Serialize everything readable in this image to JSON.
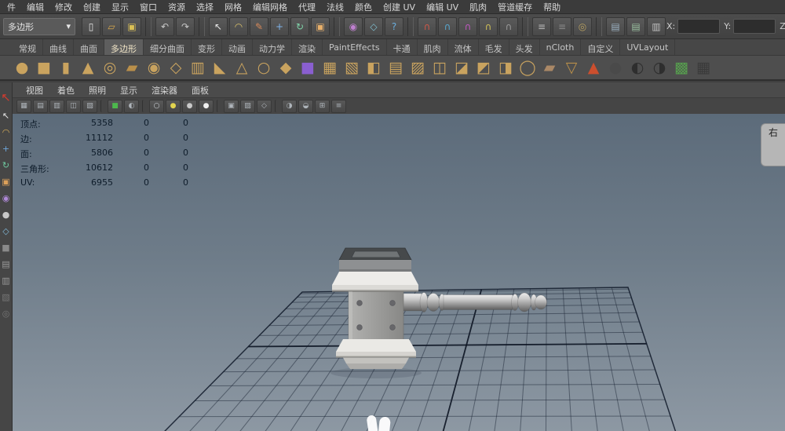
{
  "colors": {
    "viewport_top": "#5c6b7a",
    "viewport_bottom": "#8d98a3",
    "shelf_icon_tan": "#c9a35f",
    "active_tab_text": "#f2e6c8"
  },
  "menubar": {
    "items": [
      "件",
      "编辑",
      "修改",
      "创建",
      "显示",
      "窗口",
      "资源",
      "选择",
      "网格",
      "编辑网格",
      "代理",
      "法线",
      "颜色",
      "创建 UV",
      "编辑 UV",
      "肌肉",
      "管道缓存",
      "帮助"
    ]
  },
  "toolbar": {
    "menuset": "多边形",
    "menuset_caret": "▾",
    "trailing_glyph": "▾",
    "icons": [
      {
        "name": "new-scene",
        "glyph": "▯",
        "color": "#e5e5e5"
      },
      {
        "name": "open-scene",
        "glyph": "▱",
        "color": "#d9a94d"
      },
      {
        "name": "save-scene",
        "glyph": "▣",
        "color": "#d9bf55"
      },
      {
        "sep": true,
        "glyph": ""
      },
      {
        "name": "undo",
        "glyph": "↶",
        "color": "#c9c9c9"
      },
      {
        "name": "redo",
        "glyph": "↷",
        "color": "#c9c9c9"
      },
      {
        "sep": true,
        "glyph": ""
      },
      {
        "name": "select-tool",
        "glyph": "↖",
        "color": "#e8e8e8"
      },
      {
        "name": "lasso-tool",
        "glyph": "◠",
        "color": "#d9c06a"
      },
      {
        "name": "paint-select-tool",
        "glyph": "✎",
        "color": "#d98a5a"
      },
      {
        "name": "move-tool",
        "glyph": "+",
        "color": "#7fb2e8"
      },
      {
        "name": "rotate-tool",
        "glyph": "↻",
        "color": "#7fd2a8"
      },
      {
        "name": "scale-tool",
        "glyph": "▣",
        "color": "#e8b06a"
      },
      {
        "sep": true,
        "glyph": ""
      },
      {
        "name": "soft-mod",
        "glyph": "◉",
        "color": "#c080d0"
      },
      {
        "name": "show-manipulator",
        "glyph": "◇",
        "color": "#80c0d0"
      },
      {
        "name": "help",
        "glyph": "?",
        "color": "#6aaede"
      },
      {
        "sep": true,
        "glyph": ""
      },
      {
        "name": "snap-grid",
        "glyph": "∩",
        "color": "#d05848"
      },
      {
        "name": "snap-curve",
        "glyph": "∩",
        "color": "#58a8d0"
      },
      {
        "name": "snap-point",
        "glyph": "∩",
        "color": "#c058c0"
      },
      {
        "name": "snap-projected",
        "glyph": "∩",
        "color": "#d0c058"
      },
      {
        "name": "snap-view",
        "glyph": "∩",
        "color": "#9a9a9a"
      },
      {
        "sep": true,
        "glyph": ""
      },
      {
        "name": "input-connections",
        "glyph": "≡",
        "color": "#b8b8b8"
      },
      {
        "name": "output-connections",
        "glyph": "≡",
        "color": "#8a8a8a"
      },
      {
        "name": "construction-history",
        "glyph": "◎",
        "color": "#b8a060"
      },
      {
        "sep": true,
        "glyph": ""
      },
      {
        "name": "render-current-frame",
        "glyph": "▤",
        "color": "#9ab0c0"
      },
      {
        "name": "ipr-render",
        "glyph": "▤",
        "color": "#9ac0a0"
      },
      {
        "name": "render-settings",
        "glyph": "▥",
        "color": "#c0c0c0"
      }
    ],
    "axis_fields": [
      {
        "label": "X:",
        "value": ""
      },
      {
        "label": "Y:",
        "value": ""
      },
      {
        "label": "Z:",
        "value": ""
      }
    ]
  },
  "shelf": {
    "tabs": [
      {
        "label": "常规"
      },
      {
        "label": "曲线"
      },
      {
        "label": "曲面"
      },
      {
        "label": "多边形",
        "active": true
      },
      {
        "label": "细分曲面"
      },
      {
        "label": "变形"
      },
      {
        "label": "动画"
      },
      {
        "label": "动力学"
      },
      {
        "label": "渲染"
      },
      {
        "label": "PaintEffects"
      },
      {
        "label": "卡通"
      },
      {
        "label": "肌肉"
      },
      {
        "label": "流体"
      },
      {
        "label": "毛发"
      },
      {
        "label": "头发"
      },
      {
        "label": "nCloth"
      },
      {
        "label": "自定义"
      },
      {
        "label": "UVLayout"
      }
    ],
    "icons": [
      {
        "name": "poly-sphere",
        "glyph": "●",
        "color": "#c9a35f"
      },
      {
        "name": "poly-cube",
        "glyph": "■",
        "color": "#c9a35f"
      },
      {
        "name": "poly-cylinder",
        "glyph": "▮",
        "color": "#c9a35f"
      },
      {
        "name": "poly-cone",
        "glyph": "▲",
        "color": "#c9a35f"
      },
      {
        "name": "poly-torus",
        "glyph": "◎",
        "color": "#c9a35f"
      },
      {
        "name": "poly-plane",
        "glyph": "▰",
        "color": "#b98f4a"
      },
      {
        "name": "poly-disc",
        "glyph": "◉",
        "color": "#c9a35f"
      },
      {
        "name": "poly-helix",
        "glyph": "◇",
        "color": "#c9a35f"
      },
      {
        "name": "poly-pipe",
        "glyph": "▥",
        "color": "#c9a35f"
      },
      {
        "name": "poly-prism",
        "glyph": "◣",
        "color": "#c9a35f"
      },
      {
        "name": "poly-pyramid",
        "glyph": "△",
        "color": "#c9a35f"
      },
      {
        "name": "poly-soccer",
        "glyph": "○",
        "color": "#c9a35f"
      },
      {
        "name": "poly-platonic",
        "glyph": "◆",
        "color": "#c9a35f"
      },
      {
        "name": "smooth-cube",
        "glyph": "■",
        "color": "#8a5fd0"
      },
      {
        "name": "combine",
        "glyph": "▦",
        "color": "#c9a35f"
      },
      {
        "name": "extract",
        "glyph": "▧",
        "color": "#c9a35f"
      },
      {
        "name": "boolean",
        "glyph": "◧",
        "color": "#c9a35f"
      },
      {
        "name": "extrude",
        "glyph": "▤",
        "color": "#c9a35f"
      },
      {
        "name": "bridge",
        "glyph": "▨",
        "color": "#c9a35f"
      },
      {
        "name": "merge",
        "glyph": "◫",
        "color": "#c9a35f"
      },
      {
        "name": "bevel",
        "glyph": "◪",
        "color": "#c9a35f"
      },
      {
        "name": "wedge",
        "glyph": "◩",
        "color": "#c9a35f"
      },
      {
        "name": "mirror",
        "glyph": "◨",
        "color": "#c9a35f"
      },
      {
        "name": "smooth",
        "glyph": "◯",
        "color": "#c9a35f"
      },
      {
        "name": "crease",
        "glyph": "▰",
        "color": "#aa8866"
      },
      {
        "name": "reduce",
        "glyph": "▽",
        "color": "#b98f4a"
      },
      {
        "name": "sculpt-cone",
        "glyph": "▲",
        "color": "#cc4f2e"
      },
      {
        "name": "dark-sphere",
        "glyph": "●",
        "color": "#4a4a4a"
      },
      {
        "name": "checker-sphere-a",
        "glyph": "◐",
        "color": "#2e2e2e"
      },
      {
        "name": "checker-sphere-b",
        "glyph": "◑",
        "color": "#2e2e2e"
      },
      {
        "name": "uv-checker-green",
        "glyph": "▩",
        "color": "#57a04e"
      },
      {
        "name": "uv-checker-grid",
        "glyph": "▦",
        "color": "#3a3a3a"
      }
    ]
  },
  "tool_column": {
    "icons": [
      {
        "name": "select-tool",
        "glyph": "↖",
        "color": "#d23b2f"
      },
      {
        "name": "lasso-tool",
        "glyph": "↖",
        "color": "#e6e6e6"
      },
      {
        "name": "paint-select-tool",
        "glyph": "◠",
        "color": "#d9b05a"
      },
      {
        "name": "move-tool",
        "glyph": "+",
        "color": "#6fa8dc"
      },
      {
        "name": "rotate-tool",
        "glyph": "↻",
        "color": "#6fc8a0"
      },
      {
        "name": "scale-tool",
        "glyph": "▣",
        "color": "#dca05a"
      },
      {
        "name": "universal-manipulator",
        "glyph": "◉",
        "color": "#b089d8"
      },
      {
        "name": "soft-mod-tool",
        "glyph": "●",
        "color": "#c8c8c8"
      },
      {
        "name": "show-manipulator",
        "glyph": "◇",
        "color": "#80b8d8"
      },
      {
        "name": "last-tool",
        "glyph": "■",
        "color": "#8a8a8a"
      },
      {
        "name": "layout-single",
        "glyph": "▤",
        "color": "#9a9a9a"
      },
      {
        "name": "layout-four",
        "glyph": "▥",
        "color": "#9a9a9a"
      },
      {
        "name": "layout-split",
        "glyph": "▧",
        "color": "#777777"
      },
      {
        "name": "layout-outliner",
        "glyph": "◎",
        "color": "#777777"
      }
    ]
  },
  "panel": {
    "menus": [
      "视图",
      "着色",
      "照明",
      "显示",
      "渲染器",
      "面板"
    ],
    "toolbar_icons": [
      {
        "name": "grid-toggle",
        "glyph": "▦",
        "color": "#aeb4ba"
      },
      {
        "name": "film-gate",
        "glyph": "▤",
        "color": "#aeb4ba"
      },
      {
        "name": "resolution-gate",
        "glyph": "▥",
        "color": "#aeb4ba"
      },
      {
        "name": "gate-mask",
        "glyph": "◫",
        "color": "#aeb4ba"
      },
      {
        "name": "field-chart",
        "glyph": "▧",
        "color": "#aeb4ba"
      },
      {
        "sep": true,
        "glyph": ""
      },
      {
        "name": "camera-attributes",
        "glyph": "■",
        "color": "#4db84d"
      },
      {
        "name": "bookmark-camera",
        "glyph": "◐",
        "color": "#aeb4ba"
      },
      {
        "sep": true,
        "glyph": ""
      },
      {
        "name": "wireframe-mode",
        "glyph": "○",
        "color": "#cfd4d9"
      },
      {
        "name": "shaded-mode",
        "glyph": "●",
        "color": "#e3d44f"
      },
      {
        "name": "textured-mode",
        "glyph": "●",
        "color": "#c9c9c9"
      },
      {
        "name": "lights-mode",
        "glyph": "●",
        "color": "#f0f0f0"
      },
      {
        "sep": true,
        "glyph": ""
      },
      {
        "name": "isolate-select",
        "glyph": "▣",
        "color": "#aeb4ba"
      },
      {
        "name": "xray-mode",
        "glyph": "▨",
        "color": "#aeb4ba"
      },
      {
        "name": "xray-joints",
        "glyph": "◇",
        "color": "#aeb4ba"
      },
      {
        "sep": true,
        "glyph": ""
      },
      {
        "name": "exposure",
        "glyph": "◑",
        "color": "#aeb4ba"
      },
      {
        "name": "gamma",
        "glyph": "◒",
        "color": "#aeb4ba"
      },
      {
        "name": "view-axis",
        "glyph": "⊞",
        "color": "#aeb4ba"
      },
      {
        "name": "panel-options",
        "glyph": "≡",
        "color": "#aeb4ba"
      }
    ]
  },
  "hud": {
    "rows": [
      {
        "label": "顶点:",
        "v1": "5358",
        "v2": "0",
        "v3": "0"
      },
      {
        "label": "边:",
        "v1": "11112",
        "v2": "0",
        "v3": "0"
      },
      {
        "label": "面:",
        "v1": "5806",
        "v2": "0",
        "v3": "0"
      },
      {
        "label": "三角形:",
        "v1": "10612",
        "v2": "0",
        "v3": "0"
      },
      {
        "label": "UV:",
        "v1": "6955",
        "v2": "0",
        "v3": "0"
      }
    ]
  },
  "side_tab": {
    "label": "右"
  }
}
